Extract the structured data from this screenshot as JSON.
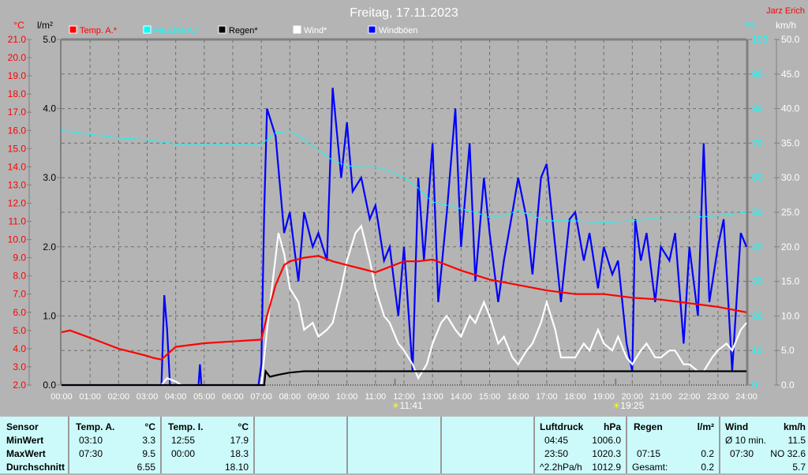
{
  "title": "Freitag, 17.11.2023",
  "author": "Jarz Erich",
  "sun": {
    "sunrise": "11:41",
    "sunset": "19:25"
  },
  "chart_data": {
    "type": "line",
    "title": "Freitag, 17.11.2023",
    "x_labels": [
      "00:00",
      "01:00",
      "02:00",
      "03:00",
      "04:00",
      "05:00",
      "06:00",
      "07:00",
      "08:00",
      "09:00",
      "10:00",
      "11:00",
      "12:00",
      "13:00",
      "14:00",
      "15:00",
      "16:00",
      "17:00",
      "18:00",
      "19:00",
      "20:00",
      "21:00",
      "22:00",
      "23:00",
      "24:00"
    ],
    "axes": {
      "temp": {
        "label": "°C",
        "min": 2,
        "max": 21,
        "step": 1,
        "color": "#ff0000"
      },
      "rain": {
        "label": "l/m²",
        "min": 0,
        "max": 5,
        "step": 1,
        "color": "#000000"
      },
      "humidity": {
        "label": "%",
        "min": 0,
        "max": 100,
        "step": 10,
        "color": "#00ffff"
      },
      "wind": {
        "label": "km/h",
        "min": 0,
        "max": 50,
        "step": 5,
        "color": "#ffffff"
      }
    },
    "grid": true,
    "legend": [
      {
        "name": "Temp. A.*",
        "color": "#ff0000"
      },
      {
        "name": "Feuchte A.*",
        "color": "#00ffff"
      },
      {
        "name": "Regen*",
        "color": "#000000"
      },
      {
        "name": "Wind*",
        "color": "#ffffff"
      },
      {
        "name": "Windböen",
        "color": "#0000ff"
      }
    ],
    "series": [
      {
        "name": "Windböen",
        "axis": "wind",
        "color": "#0000ff",
        "x": [
          0,
          3.5,
          3.6,
          3.7,
          3.8,
          3.9,
          4.8,
          4.85,
          4.9,
          6.9,
          7.0,
          7.1,
          7.2,
          7.5,
          7.8,
          8.0,
          8.3,
          8.5,
          8.8,
          9.0,
          9.3,
          9.5,
          9.8,
          10.0,
          10.2,
          10.5,
          10.8,
          11.0,
          11.3,
          11.5,
          11.8,
          12.0,
          12.3,
          12.5,
          12.7,
          13.0,
          13.2,
          13.5,
          13.8,
          14.0,
          14.3,
          14.5,
          14.8,
          15.0,
          15.3,
          15.5,
          15.8,
          16.0,
          16.3,
          16.5,
          16.8,
          17.0,
          17.3,
          17.5,
          17.8,
          18.0,
          18.3,
          18.5,
          18.8,
          19.0,
          19.3,
          19.5,
          19.8,
          20.0,
          20.1,
          20.3,
          20.5,
          20.8,
          21.0,
          21.3,
          21.5,
          21.8,
          22.0,
          22.3,
          22.5,
          22.7,
          23.0,
          23.2,
          23.5,
          23.8,
          24.0
        ],
        "values": [
          0,
          0,
          13,
          8,
          0,
          0,
          0,
          3,
          0,
          0,
          3,
          25,
          40,
          36,
          22,
          25,
          15,
          25,
          20,
          22,
          18,
          43,
          30,
          38,
          28,
          30,
          24,
          26,
          18,
          20,
          10,
          20,
          2,
          30,
          18,
          35,
          12,
          25,
          40,
          20,
          35,
          15,
          30,
          22,
          12,
          18,
          25,
          30,
          24,
          16,
          30,
          32,
          20,
          12,
          24,
          25,
          18,
          22,
          14,
          20,
          16,
          18,
          6,
          2,
          24,
          18,
          22,
          12,
          20,
          18,
          22,
          6,
          20,
          10,
          35,
          12,
          20,
          24,
          2,
          22,
          20
        ]
      },
      {
        "name": "Wind*",
        "axis": "wind",
        "color": "#ffffff",
        "x": [
          0,
          3.5,
          3.7,
          4.0,
          4.2,
          6.9,
          7.0,
          7.2,
          7.4,
          7.6,
          7.8,
          8.0,
          8.3,
          8.5,
          8.8,
          9.0,
          9.3,
          9.5,
          9.8,
          10.0,
          10.3,
          10.5,
          10.8,
          11.0,
          11.3,
          11.5,
          11.8,
          12.0,
          12.3,
          12.5,
          12.8,
          13.0,
          13.3,
          13.5,
          13.8,
          14.0,
          14.3,
          14.5,
          14.8,
          15.0,
          15.3,
          15.5,
          15.8,
          16.0,
          16.3,
          16.5,
          16.8,
          17.0,
          17.3,
          17.5,
          17.8,
          18.0,
          18.3,
          18.5,
          18.8,
          19.0,
          19.3,
          19.5,
          19.8,
          20.0,
          20.3,
          20.5,
          20.8,
          21.0,
          21.3,
          21.5,
          21.8,
          22.0,
          22.3,
          22.5,
          22.8,
          23.0,
          23.3,
          23.5,
          23.8,
          24.0
        ],
        "values": [
          0,
          0,
          1,
          0.5,
          0,
          0,
          0,
          8,
          15,
          22,
          19,
          14,
          12,
          8,
          9,
          7,
          8,
          9,
          14,
          18,
          22,
          23,
          18,
          14,
          10,
          9,
          6,
          5,
          3,
          1,
          3,
          6,
          9,
          10,
          8,
          7,
          10,
          9,
          12,
          10,
          6,
          7,
          4,
          3,
          5,
          6,
          9,
          12,
          8,
          4,
          4,
          4,
          6,
          5,
          8,
          6,
          5,
          7,
          4,
          3,
          5,
          6,
          4,
          4,
          5,
          5,
          3,
          3,
          2,
          2,
          4,
          5,
          6,
          5,
          8,
          9
        ]
      },
      {
        "name": "Temp. A.*",
        "axis": "temp",
        "color": "#ff0000",
        "x": [
          0,
          0.3,
          1,
          2,
          3,
          3.2,
          3.5,
          4,
          5,
          6,
          7,
          7.2,
          7.5,
          7.8,
          8,
          8.5,
          9,
          9.5,
          10,
          10.5,
          11,
          11.5,
          12,
          12.5,
          13,
          13.5,
          14,
          15,
          16,
          17,
          18,
          19,
          20,
          21,
          22,
          23,
          24
        ],
        "values": [
          4.9,
          5.0,
          4.6,
          4.0,
          3.6,
          3.5,
          3.4,
          4.1,
          4.3,
          4.4,
          4.5,
          5.8,
          7.5,
          8.6,
          8.8,
          9.0,
          9.1,
          8.8,
          8.6,
          8.4,
          8.2,
          8.5,
          8.8,
          8.8,
          8.9,
          8.6,
          8.3,
          7.8,
          7.5,
          7.2,
          7.0,
          7.0,
          6.8,
          6.7,
          6.5,
          6.3,
          6.0
        ]
      },
      {
        "name": "Feuchte A.*",
        "axis": "humidity",
        "color": "#00ffff",
        "x": [
          0,
          1,
          2,
          3,
          4,
          5,
          6,
          7,
          7.5,
          8,
          8.5,
          9,
          9.5,
          10,
          10.5,
          11,
          11.5,
          12,
          12.5,
          13,
          13.5,
          14,
          14.5,
          15,
          15.5,
          16,
          16.5,
          17,
          18,
          19,
          20,
          21,
          22,
          23,
          24
        ],
        "values": [
          73.7,
          72.5,
          71.5,
          71,
          69.7,
          69.7,
          69.7,
          69.7,
          73,
          73.5,
          71,
          68,
          65,
          63.5,
          63,
          63,
          62,
          60,
          57,
          53,
          52,
          51,
          50,
          48.5,
          49,
          50.5,
          49,
          47.5,
          47.5,
          47,
          47.5,
          48.5,
          48.5,
          49,
          50
        ]
      },
      {
        "name": "Regen*",
        "axis": "rain",
        "color": "#000000",
        "x": [
          0,
          7.1,
          7.15,
          7.3,
          7.6,
          8,
          8.5,
          24
        ],
        "values": [
          0,
          0,
          0.2,
          0.12,
          0.15,
          0.18,
          0.2,
          0.2
        ]
      }
    ]
  },
  "footer": {
    "temp_out": {
      "header": [
        "Sensor",
        "Temp. A.",
        "°C"
      ],
      "rows": [
        [
          "MinWert",
          "03:10",
          "3.3"
        ],
        [
          "MaxWert",
          "07:30",
          "9.5"
        ],
        [
          "Durchschnitt",
          "",
          "6.55"
        ]
      ]
    },
    "temp_in": {
      "header": [
        "Temp. I.",
        "°C"
      ],
      "rows": [
        [
          "12:55",
          "17.9"
        ],
        [
          "00:00",
          "18.3"
        ],
        [
          "",
          "18.10"
        ]
      ]
    },
    "pressure": {
      "header": [
        "Luftdruck",
        "hPa"
      ],
      "rows": [
        [
          "04:45",
          "1006.0"
        ],
        [
          "23:50",
          "1020.3"
        ],
        [
          "^2.2hPa/h",
          "1012.9"
        ]
      ]
    },
    "rain": {
      "header": [
        "Regen",
        "l/m²"
      ],
      "rows": [
        [
          "",
          ""
        ],
        [
          "07:15",
          "0.2"
        ],
        [
          "Gesamt:",
          "0.2"
        ]
      ]
    },
    "wind": {
      "header": [
        "Wind",
        "km/h"
      ],
      "rows": [
        [
          "Ø 10 min.",
          "11.5"
        ],
        [
          "07:30",
          "NO 32.6"
        ],
        [
          "",
          "5.7"
        ]
      ]
    }
  }
}
